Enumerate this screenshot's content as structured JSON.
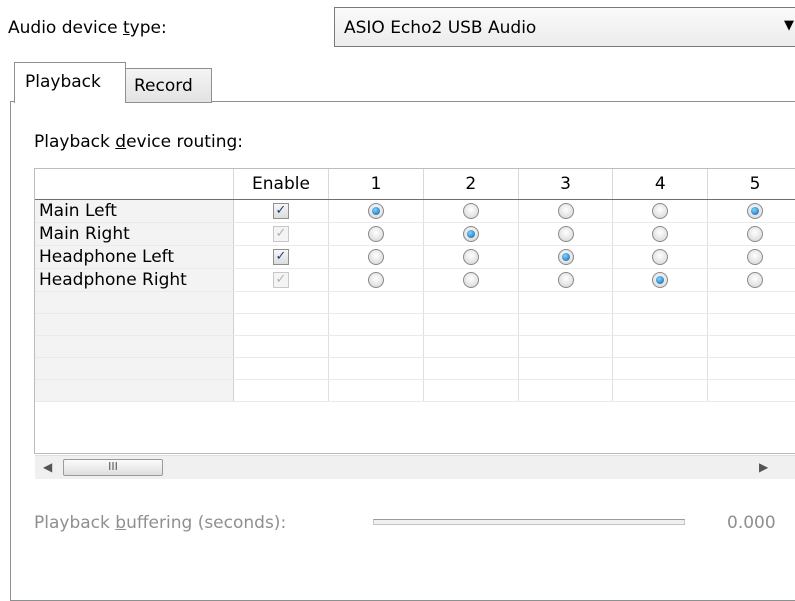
{
  "device": {
    "label_pre": "Audio device ",
    "label_u": "t",
    "label_post": "ype:",
    "selected": "ASIO Echo2 USB Audio"
  },
  "tabs": [
    {
      "label": "Playback",
      "selected": true
    },
    {
      "label": "Record",
      "selected": false
    }
  ],
  "routing": {
    "label_pre": "Playback ",
    "label_u": "d",
    "label_post": "evice routing:",
    "columns": [
      "Enable",
      "1",
      "2",
      "3",
      "4",
      "5"
    ],
    "rows": [
      {
        "name": "Main Left",
        "enabled": true,
        "enabled_dim": false,
        "selected": 1
      },
      {
        "name": "Main Right",
        "enabled": true,
        "enabled_dim": true,
        "selected": 2
      },
      {
        "name": "Headphone Left",
        "enabled": true,
        "enabled_dim": false,
        "selected": 3
      },
      {
        "name": "Headphone Right",
        "enabled": true,
        "enabled_dim": true,
        "selected": 4
      }
    ],
    "empty_rows": 5
  },
  "scrollbar": {
    "thumb_grip": "III"
  },
  "buffering": {
    "label_pre": "Playback ",
    "label_u": "b",
    "label_post": "uffering (seconds):",
    "value": "0.000"
  },
  "colors": {
    "radio_on": "#0b5fa8",
    "check": "#1d3c8a",
    "disabled_text": "#8f8f8f"
  }
}
